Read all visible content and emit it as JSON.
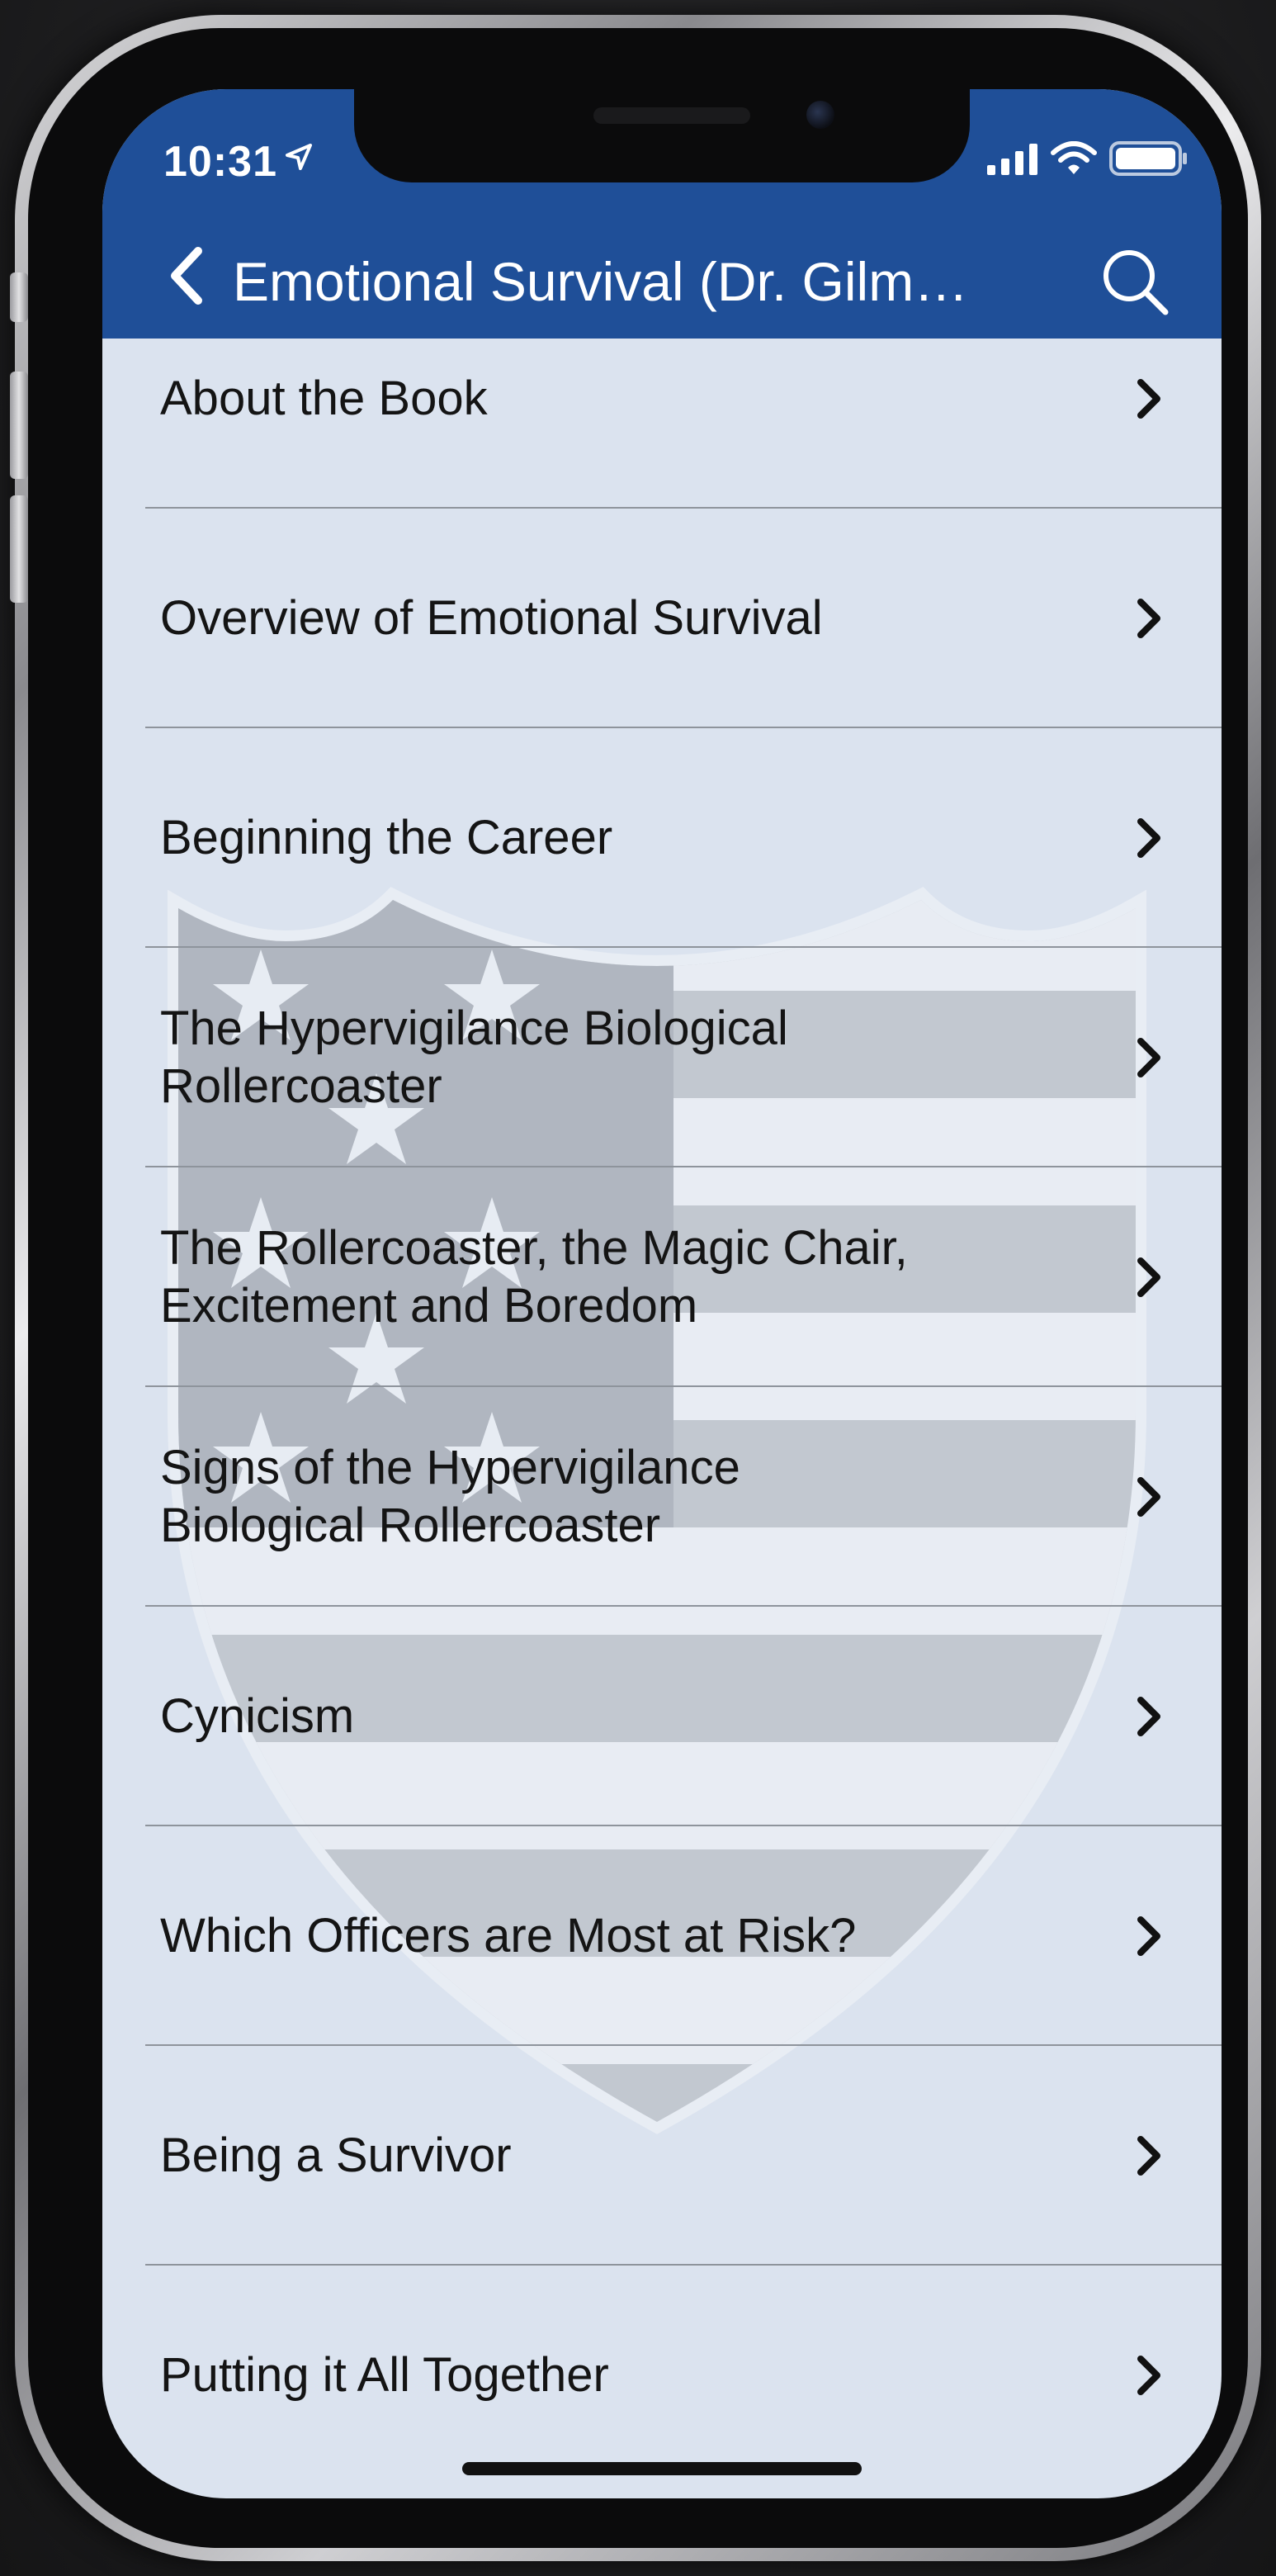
{
  "status_bar": {
    "time": "10:31"
  },
  "nav": {
    "title": "Emotional Survival (Dr. Gilm…"
  },
  "colors": {
    "header": "#1f4f98",
    "list_background": "#dbe3ef",
    "text": "#141414"
  },
  "list": {
    "items": [
      {
        "label": "About the Book"
      },
      {
        "label": "Overview of Emotional Survival"
      },
      {
        "label": "Beginning the Career"
      },
      {
        "label": "The Hypervigilance Biological\nRollercoaster"
      },
      {
        "label": "The Rollercoaster, the Magic Chair,\nExcitement and Boredom"
      },
      {
        "label": "Signs of the Hypervigilance\nBiological Rollercoaster"
      },
      {
        "label": "Cynicism"
      },
      {
        "label": "Which Officers are Most at Risk?"
      },
      {
        "label": "Being a Survivor"
      },
      {
        "label": "Putting it All Together"
      }
    ]
  }
}
